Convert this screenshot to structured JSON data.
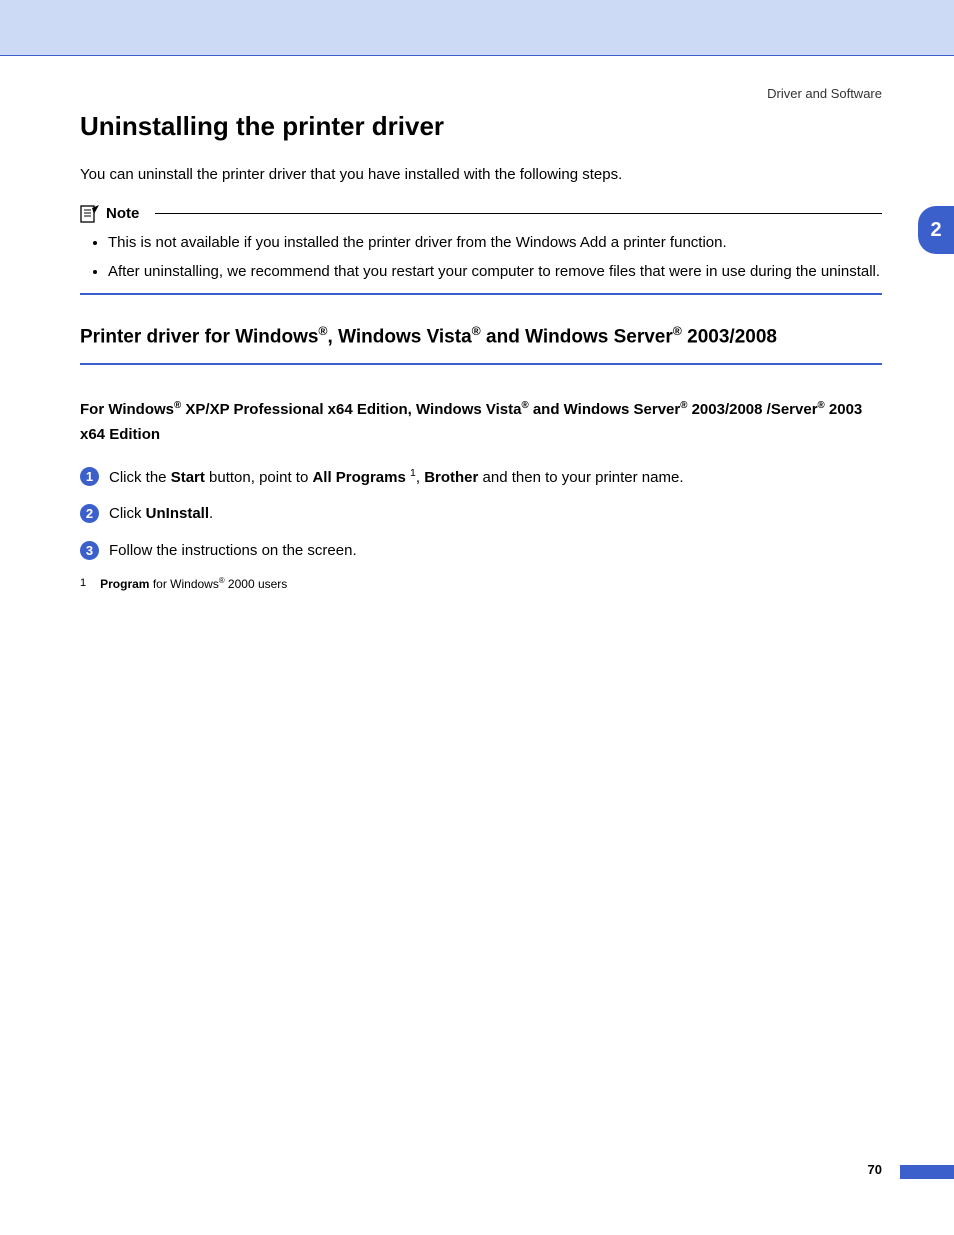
{
  "header": {
    "label": "Driver and Software"
  },
  "chapter_tab": "2",
  "page_number": "70",
  "title": "Uninstalling the printer driver",
  "intro": "You can uninstall the printer driver that you have installed with the following steps.",
  "note": {
    "label": "Note",
    "items": [
      "This is not available if you installed the printer driver from the Windows Add a printer function.",
      "After uninstalling, we recommend that you restart your computer to remove files that were in use during the uninstall."
    ]
  },
  "section": {
    "title_parts": {
      "p1": "Printer driver for Windows",
      "p2": ", Windows Vista",
      "p3": " and Windows Server",
      "p4": " 2003/2008"
    },
    "subtitle_parts": {
      "s1": "For Windows",
      "s2": " XP/XP Professional x64 Edition, Windows Vista",
      "s3": " and Windows Server",
      "s4": " 2003/2008 /Server",
      "s5": " 2003 x64 Edition"
    }
  },
  "steps": {
    "n1": "1",
    "n2": "2",
    "n3": "3",
    "s1": {
      "t1": "Click the ",
      "b1": "Start",
      "t2": " button, point to ",
      "b2": "All Programs",
      "fn": "1",
      "t3": ", ",
      "b3": "Brother",
      "t4": " and then to your printer name."
    },
    "s2": {
      "t1": "Click ",
      "b1": "UnInstall",
      "t2": "."
    },
    "s3": {
      "t1": "Follow the instructions on the screen."
    }
  },
  "footnote": {
    "num": "1",
    "b1": "Program",
    "t1": " for Windows",
    "t2": " 2000 users"
  },
  "reg": "®"
}
